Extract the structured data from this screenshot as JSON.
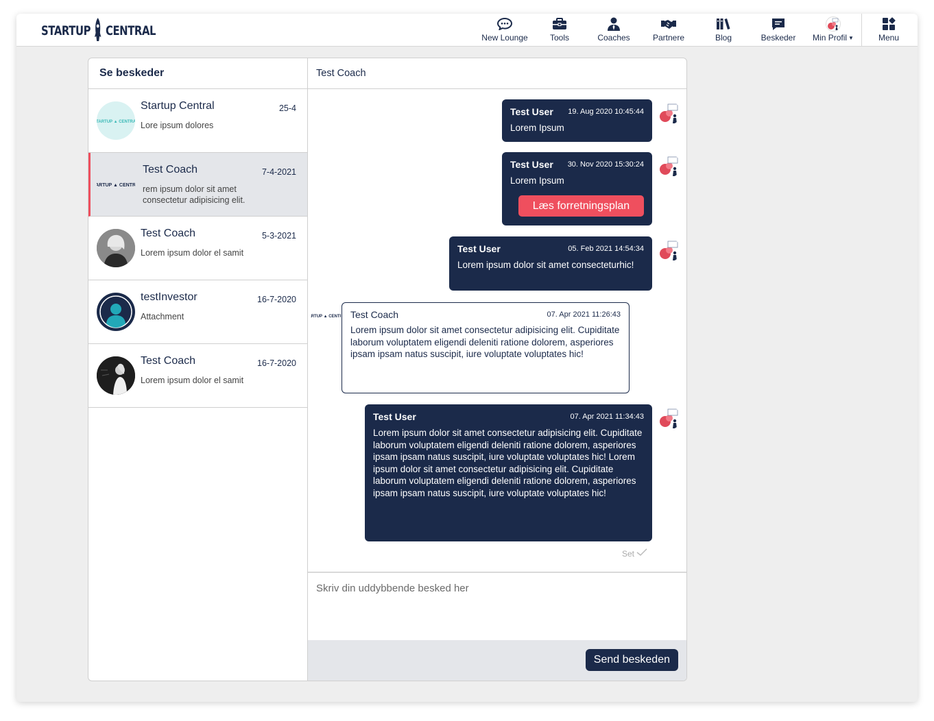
{
  "brand": {
    "left": "STARTUP",
    "right": "CENTRAL"
  },
  "nav": [
    {
      "label": "New Lounge",
      "icon": "chat-bubble-icon"
    },
    {
      "label": "Tools",
      "icon": "briefcase-icon"
    },
    {
      "label": "Coaches",
      "icon": "person-tie-icon"
    },
    {
      "label": "Partnere",
      "icon": "handshake-icon"
    },
    {
      "label": "Blog",
      "icon": "books-icon"
    },
    {
      "label": "Beskeder",
      "icon": "message-icon"
    },
    {
      "label": "Min Profil",
      "icon": "profile-avatar-icon"
    },
    {
      "label": "Menu",
      "icon": "grid-menu-icon"
    }
  ],
  "inbox": {
    "title": "Se beskeder",
    "conversations": [
      {
        "name": "Startup Central",
        "date": "25-4",
        "preview": "Lore ipsum dolores",
        "avatar": "startup-central-logo",
        "active": false
      },
      {
        "name": "Test Coach",
        "date": "7-4-2021",
        "preview": "rem ipsum dolor sit amet consectetur adipisicing elit. Cupiditate laborum voluptatem",
        "avatar": "startup-central-logo",
        "active": true
      },
      {
        "name": "Test Coach",
        "date": "5-3-2021",
        "preview": "Lorem ipsum dolor el samit",
        "avatar": "photo-woman",
        "active": false
      },
      {
        "name": "testInvestor",
        "date": "16-7-2020",
        "preview": "Attachment",
        "avatar": "default-user",
        "active": false
      },
      {
        "name": "Test Coach",
        "date": "16-7-2020",
        "preview": "Lorem ipsum dolor el samit",
        "avatar": "photo-woman-dark",
        "active": false
      }
    ]
  },
  "thread": {
    "title": "Test Coach",
    "messages": [
      {
        "sender": "Test User",
        "time": "19. Aug 2020 10:45:44",
        "body": "Lorem Ipsum"
      },
      {
        "sender": "Test User",
        "time": "30. Nov 2020 15:30:24",
        "body": "Lorem Ipsum",
        "button": "Læs forretningsplan"
      },
      {
        "sender": "Test User",
        "time": "05. Feb 2021 14:54:34",
        "body": "Lorem ipsum dolor sit amet consecteturhic!"
      },
      {
        "sender": "Test Coach",
        "time": "07. Apr 2021 11:26:43",
        "body": "Lorem ipsum dolor sit amet consectetur adipisicing elit. Cupiditate laborum voluptatem eligendi deleniti ratione dolorem, asperiores ipsam ipsam natus suscipit, iure voluptate voluptates hic!"
      },
      {
        "sender": "Test User",
        "time": "07. Apr 2021 11:34:43",
        "body": "Lorem ipsum dolor sit amet consectetur adipisicing elit. Cupiditate laborum voluptatem eligendi deleniti ratione dolorem, asperiores ipsam ipsam natus suscipit, iure voluptate voluptates hic! Lorem ipsum dolor sit amet consectetur adipisicing elit. Cupiditate laborum voluptatem eligendi deleniti ratione dolorem, asperiores ipsam ipsam natus suscipit, iure voluptate voluptates hic!"
      }
    ],
    "seen_label": "Set"
  },
  "compose": {
    "placeholder": "Skriv din uddybbende besked her",
    "send_label": "Send beskeden"
  },
  "colors": {
    "navy": "#1b2a4a",
    "accent_red": "#ef4f5e",
    "background": "#eeeeee",
    "active_row": "#e4e6ea"
  }
}
